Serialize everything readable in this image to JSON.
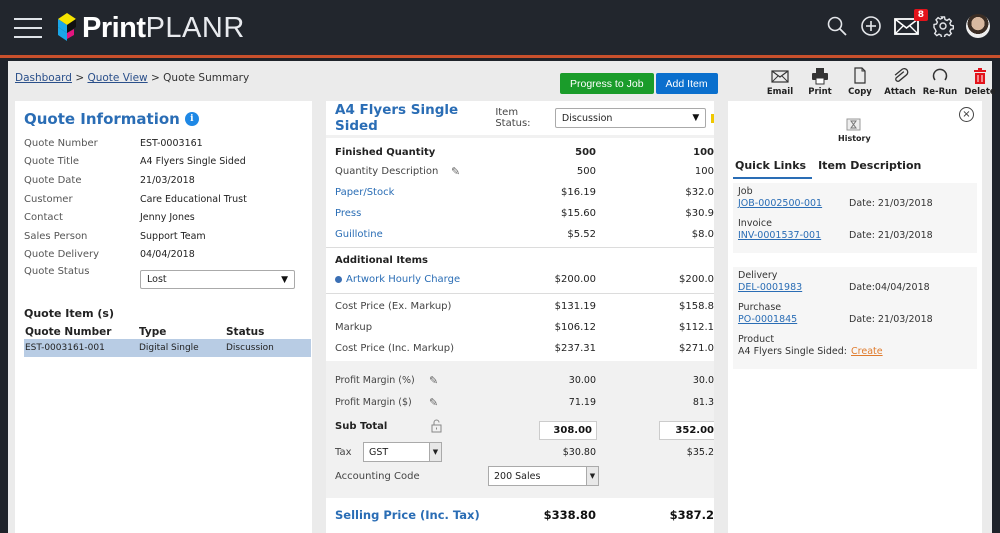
{
  "app": {
    "brand_bold": "Print",
    "brand_light": "PLANR",
    "notification_count": "8",
    "colors": {
      "accent_bar": "#c9502c",
      "brand_blue": "#2a6db5",
      "progress_green": "#1a9c2a",
      "add_blue": "#0a6fcd",
      "delete_red": "#e3131b",
      "badge_red": "#e3131b"
    }
  },
  "breadcrumb": {
    "items": [
      "Dashboard",
      "Quote View"
    ],
    "separator": ">",
    "current": "Quote Summary"
  },
  "quote_info": {
    "title": "Quote Information",
    "info_glyph": "i",
    "fields": [
      {
        "label": "Quote Number",
        "value": "EST-0003161"
      },
      {
        "label": "Quote Title",
        "value": "A4 Flyers Single Sided"
      },
      {
        "label": "Quote Date",
        "value": "21/03/2018"
      },
      {
        "label": "Customer",
        "value": "Care Educational Trust"
      },
      {
        "label": "Contact",
        "value": "Jenny Jones"
      },
      {
        "label": "Sales Person",
        "value": "Support Team"
      },
      {
        "label": "Quote Delivery",
        "value": "04/04/2018"
      }
    ],
    "status_label": "Quote Status",
    "status_value": "Lost"
  },
  "quote_items": {
    "title": "Quote Item (s)",
    "columns": [
      "Quote Number",
      "Type",
      "Status"
    ],
    "rows": [
      {
        "number": "EST-0003161-001",
        "type": "Digital Single",
        "status": "Discussion"
      }
    ]
  },
  "actions": {
    "progress_label": "Progress to Job",
    "add_item_label": "Add Item"
  },
  "toolbar": [
    {
      "icon": "email-icon",
      "label": "Email"
    },
    {
      "icon": "print-icon",
      "label": "Print"
    },
    {
      "icon": "copy-icon",
      "label": "Copy"
    },
    {
      "icon": "attach-icon",
      "label": "Attach"
    },
    {
      "icon": "rerun-icon",
      "label": "Re-Run"
    },
    {
      "icon": "delete-icon",
      "label": "Delete"
    }
  ],
  "item": {
    "title": "A4 Flyers Single Sided",
    "status_label": "Item Status:",
    "status_value": "Discussion",
    "finished_quantity": {
      "label": "Finished Quantity",
      "q1": "500",
      "q2": "100"
    },
    "quantity_description": {
      "label": "Quantity Description",
      "q1": "500",
      "q2": "100"
    },
    "cost_lines": [
      {
        "label": "Paper/Stock",
        "q1": "$16.19",
        "q2": "$32.0"
      },
      {
        "label": "Press",
        "q1": "$15.60",
        "q2": "$30.9"
      },
      {
        "label": "Guillotine",
        "q1": "$5.52",
        "q2": "$8.0"
      }
    ],
    "additional_title": "Additional Items",
    "additional": [
      {
        "label": "Artwork Hourly Charge",
        "q1": "$200.00",
        "q2": "$200.0"
      }
    ],
    "totals": [
      {
        "label": "Cost Price (Ex. Markup)",
        "q1": "$131.19",
        "q2": "$158.8"
      },
      {
        "label": "Markup",
        "q1": "$106.12",
        "q2": "$112.1"
      },
      {
        "label": "Cost Price (Inc. Markup)",
        "q1": "$237.31",
        "q2": "$271.0"
      }
    ],
    "profit_margin_pct": {
      "label": "Profit Margin (%)",
      "q1": "30.00",
      "q2": "30.0"
    },
    "profit_margin_amt": {
      "label": "Profit Margin ($)",
      "q1": "71.19",
      "q2": "81.3"
    },
    "sub_total": {
      "label": "Sub Total",
      "q1": "308.00",
      "q2": "352.00"
    },
    "tax": {
      "label": "Tax",
      "select": "GST",
      "q1": "$30.80",
      "q2": "$35.2"
    },
    "accounting": {
      "label": "Accounting Code",
      "select": "200 Sales"
    },
    "selling_price": {
      "label": "Selling Price (Inc. Tax)",
      "q1": "$338.80",
      "q2": "$387.2"
    }
  },
  "side_panel": {
    "history_label": "History",
    "close_glyph": "×",
    "tabs": [
      "Quick Links",
      "Item Description"
    ],
    "links": [
      {
        "title": "Job",
        "link": "JOB-0002500-001",
        "date": "Date: 21/03/2018"
      },
      {
        "title": "Invoice",
        "link": "INV-0001537-001",
        "date": "Date: 21/03/2018"
      },
      {
        "title": "Delivery",
        "link": "DEL-0001983",
        "date": "Date:04/04/2018"
      },
      {
        "title": "Purchase",
        "link": "PO-0001845",
        "date": "Date: 21/03/2018"
      }
    ],
    "product": {
      "title": "Product",
      "text": "A4 Flyers Single Sided:",
      "action": "Create"
    }
  }
}
